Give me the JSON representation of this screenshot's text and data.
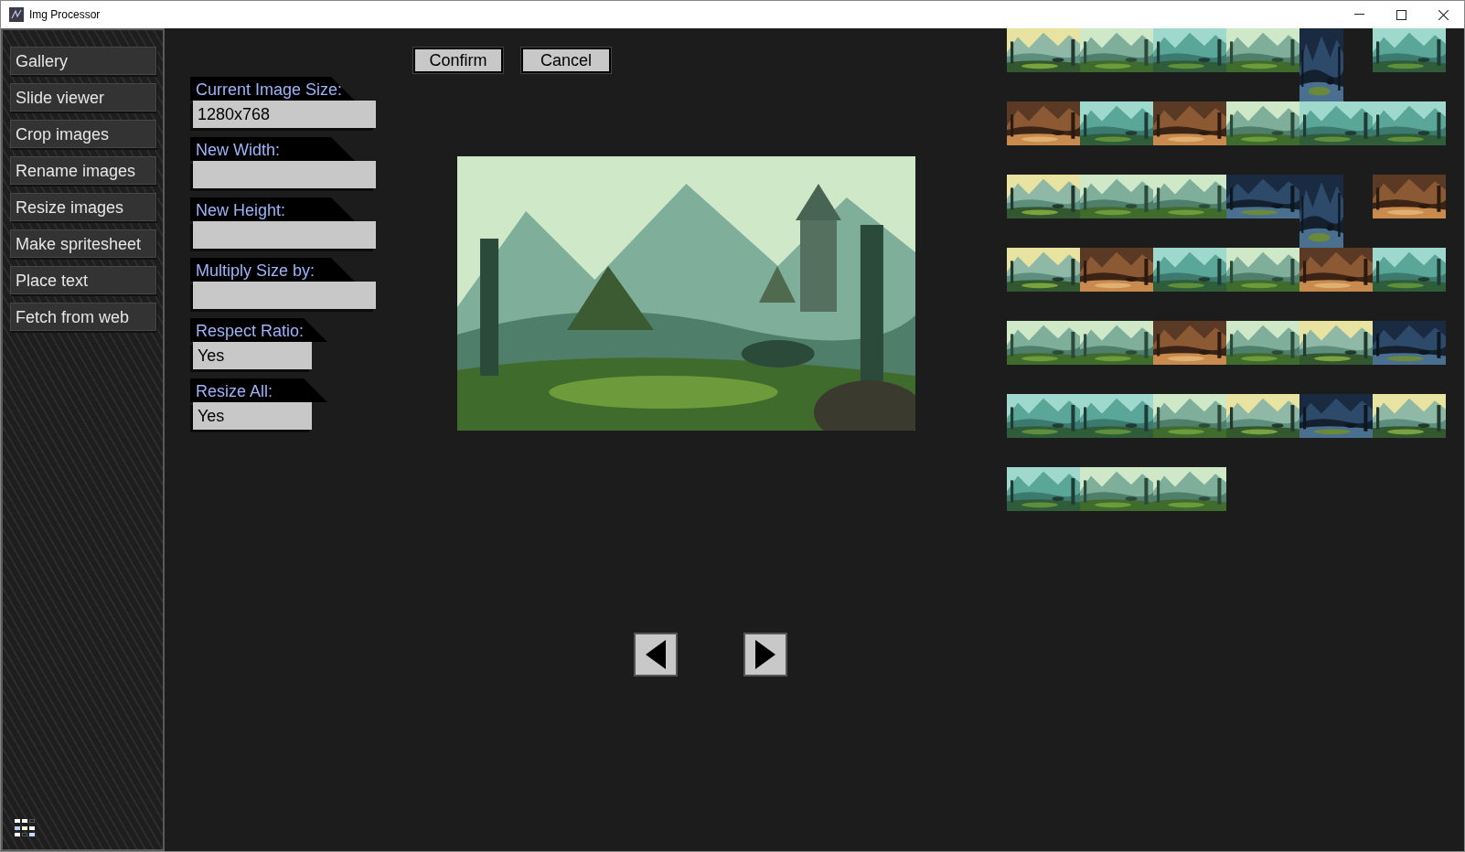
{
  "window": {
    "title": "Img Processor"
  },
  "sidebar": {
    "items": [
      {
        "label": "Gallery"
      },
      {
        "label": "Slide viewer"
      },
      {
        "label": "Crop images"
      },
      {
        "label": "Rename images"
      },
      {
        "label": "Resize images"
      },
      {
        "label": "Make spritesheet"
      },
      {
        "label": "Place text"
      },
      {
        "label": "Fetch from web"
      }
    ]
  },
  "actions": [
    "Confirm",
    "Cancel"
  ],
  "fields": [
    {
      "label": "Current Image Size:",
      "value": "1280x768",
      "kind": "wide"
    },
    {
      "label": "New Width:",
      "kind": "wide"
    },
    {
      "label": "New Height:",
      "kind": "wide"
    },
    {
      "label": "Multiply Size by:",
      "kind": "wide"
    },
    {
      "label": "Respect Ratio:",
      "value": "Yes",
      "kind": "narrow"
    },
    {
      "label": "Resize All:",
      "value": "Yes",
      "kind": "narrow"
    }
  ],
  "thumbnails": [
    {
      "kind": "wide"
    },
    {
      "kind": "wide"
    },
    {
      "kind": "wide"
    },
    {
      "kind": "wide"
    },
    {
      "kind": "tall"
    },
    {
      "kind": "wide"
    },
    {
      "kind": "wide"
    },
    {
      "kind": "wide"
    },
    {
      "kind": "wide"
    },
    {
      "kind": "wide"
    },
    {
      "kind": "wide"
    },
    {
      "kind": "wide"
    },
    {
      "kind": "wide"
    },
    {
      "kind": "wide"
    },
    {
      "kind": "wide"
    },
    {
      "kind": "wide"
    },
    {
      "kind": "tall"
    },
    {
      "kind": "wide"
    },
    {
      "kind": "wide"
    },
    {
      "kind": "wide"
    },
    {
      "kind": "wide"
    },
    {
      "kind": "wide"
    },
    {
      "kind": "wide"
    },
    {
      "kind": "wide"
    },
    {
      "kind": "wide"
    },
    {
      "kind": "wide"
    },
    {
      "kind": "wide"
    },
    {
      "kind": "wide"
    },
    {
      "kind": "wide"
    },
    {
      "kind": "wide"
    },
    {
      "kind": "wide"
    },
    {
      "kind": "wide"
    },
    {
      "kind": "wide"
    },
    {
      "kind": "wide"
    },
    {
      "kind": "wide"
    },
    {
      "kind": "wide"
    },
    {
      "kind": "wide"
    },
    {
      "kind": "wide"
    },
    {
      "kind": "wide"
    }
  ]
}
